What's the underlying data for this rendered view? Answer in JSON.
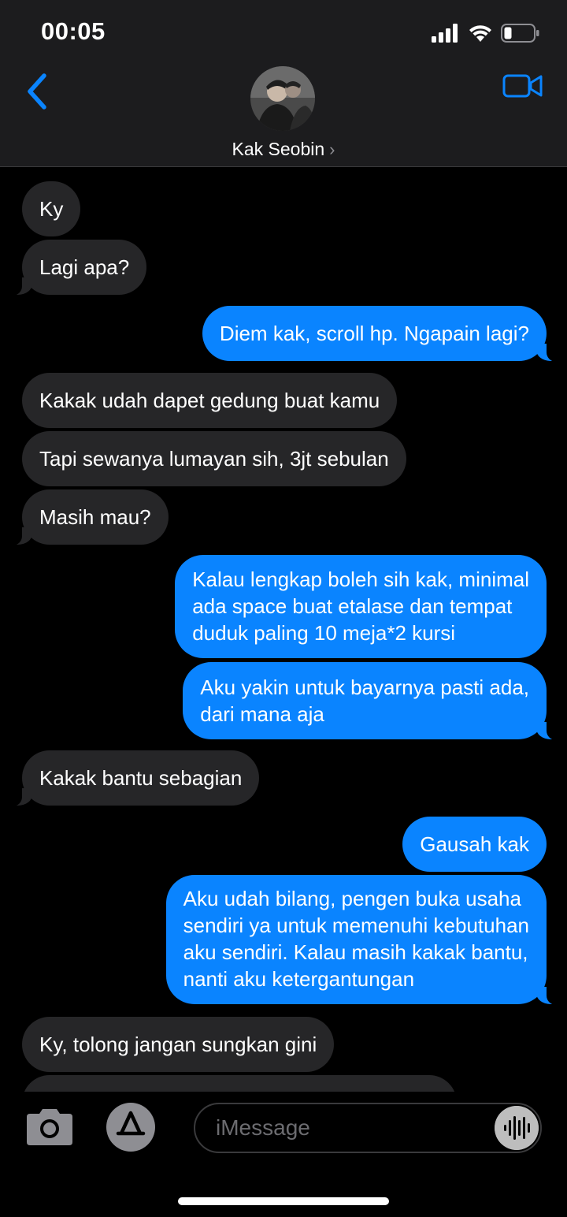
{
  "status": {
    "time": "00:05"
  },
  "header": {
    "contact_name": "Kak Seobin",
    "chevron": "›"
  },
  "messages": [
    {
      "from": "them",
      "lines": [
        "Ky"
      ]
    },
    {
      "from": "them",
      "lines": [
        "Lagi apa?"
      ]
    },
    {
      "from": "me",
      "lines": [
        "Diem kak, scroll hp. Ngapain lagi?"
      ]
    },
    {
      "from": "them",
      "lines": [
        "Kakak udah dapet gedung buat kamu"
      ]
    },
    {
      "from": "them",
      "lines": [
        "Tapi sewanya lumayan sih, 3jt sebulan"
      ]
    },
    {
      "from": "them",
      "lines": [
        "Masih mau?"
      ]
    },
    {
      "from": "me",
      "lines": [
        "Kalau lengkap boleh sih kak, minimal",
        "ada space buat etalase dan tempat",
        "duduk paling 10 meja*2 kursi"
      ]
    },
    {
      "from": "me",
      "lines": [
        "Aku yakin untuk bayarnya pasti ada,",
        "dari mana aja"
      ]
    },
    {
      "from": "them",
      "lines": [
        "Kakak bantu sebagian"
      ]
    },
    {
      "from": "me",
      "lines": [
        "Gausah kak"
      ]
    },
    {
      "from": "me",
      "lines": [
        "Aku udah bilang, pengen buka usaha",
        "sendiri ya untuk memenuhi kebutuhan",
        "aku sendiri. Kalau masih kakak bantu,",
        "nanti aku ketergantungan"
      ]
    },
    {
      "from": "them",
      "lines": [
        "Ky, tolong jangan sungkan gini"
      ]
    }
  ],
  "input": {
    "placeholder": "iMessage"
  },
  "colors": {
    "outgoing": "#0a84ff",
    "incoming": "#262628",
    "accent": "#0a84ff"
  },
  "icons": [
    "signal-icon",
    "wifi-icon",
    "battery-icon",
    "back-chevron-icon",
    "video-call-icon",
    "camera-icon",
    "app-store-icon",
    "audio-message-icon"
  ]
}
